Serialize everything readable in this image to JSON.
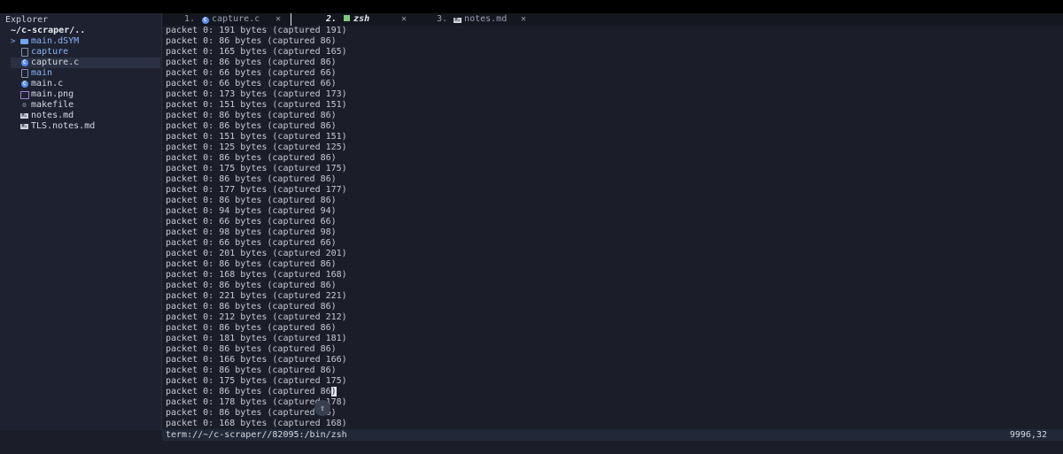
{
  "sidebar": {
    "title": "Explorer",
    "root": "~/c-scraper/..",
    "items": [
      {
        "label": "main.dSYM",
        "icon": "folder-icon",
        "caret": ">",
        "color": "blue"
      },
      {
        "label": "capture",
        "icon": "file-icon",
        "color": "blue"
      },
      {
        "label": "capture.c",
        "icon": "c-file-icon",
        "color": "light",
        "selected": true
      },
      {
        "label": "main",
        "icon": "file-icon",
        "color": "blue"
      },
      {
        "label": "main.c",
        "icon": "c-file-icon",
        "color": "light"
      },
      {
        "label": "main.png",
        "icon": "image-file-icon",
        "color": "light"
      },
      {
        "label": "makefile",
        "icon": "makefile-icon",
        "color": "light"
      },
      {
        "label": "notes.md",
        "icon": "markdown-file-icon",
        "color": "light"
      },
      {
        "label": "TLS.notes.md",
        "icon": "markdown-file-icon",
        "color": "light"
      }
    ]
  },
  "tabs": [
    {
      "num": "1.",
      "label": "capture.c",
      "icon": "c-file-icon",
      "active": false,
      "close": "✕"
    },
    {
      "num": "2.",
      "label": "zsh",
      "icon": "terminal-icon",
      "active": true,
      "close": "✕"
    },
    {
      "num": "3.",
      "label": "notes.md",
      "icon": "markdown-file-icon",
      "active": false,
      "close": "✕"
    }
  ],
  "terminal": {
    "lines": [
      "packet 0: 191 bytes (captured 191)",
      "packet 0: 86 bytes (captured 86)",
      "packet 0: 165 bytes (captured 165)",
      "packet 0: 86 bytes (captured 86)",
      "packet 0: 66 bytes (captured 66)",
      "packet 0: 66 bytes (captured 66)",
      "packet 0: 173 bytes (captured 173)",
      "packet 0: 151 bytes (captured 151)",
      "packet 0: 86 bytes (captured 86)",
      "packet 0: 86 bytes (captured 86)",
      "packet 0: 151 bytes (captured 151)",
      "packet 0: 125 bytes (captured 125)",
      "packet 0: 86 bytes (captured 86)",
      "packet 0: 175 bytes (captured 175)",
      "packet 0: 86 bytes (captured 86)",
      "packet 0: 177 bytes (captured 177)",
      "packet 0: 86 bytes (captured 86)",
      "packet 0: 94 bytes (captured 94)",
      "packet 0: 66 bytes (captured 66)",
      "packet 0: 98 bytes (captured 98)",
      "packet 0: 66 bytes (captured 66)",
      "packet 0: 201 bytes (captured 201)",
      "packet 0: 86 bytes (captured 86)",
      "packet 0: 168 bytes (captured 168)",
      "packet 0: 86 bytes (captured 86)",
      "packet 0: 221 bytes (captured 221)",
      "packet 0: 86 bytes (captured 86)",
      "packet 0: 212 bytes (captured 212)",
      "packet 0: 86 bytes (captured 86)",
      "packet 0: 181 bytes (captured 181)",
      "packet 0: 86 bytes (captured 86)",
      "packet 0: 166 bytes (captured 166)",
      "packet 0: 86 bytes (captured 86)",
      "packet 0: 175 bytes (captured 175)",
      "packet 0: 86 bytes (captured 86)",
      "packet 0: 178 bytes (captured 178)",
      "packet 0: 86 bytes (captured 86)",
      "packet 0: 168 bytes (captured 168)"
    ],
    "cursor_line": 34
  },
  "status": {
    "left": "term://~/c-scraper//82095:/bin/zsh",
    "right": "9996,32"
  },
  "colors": {
    "accent": "#8ab4f8",
    "background": "#1b1e28"
  }
}
